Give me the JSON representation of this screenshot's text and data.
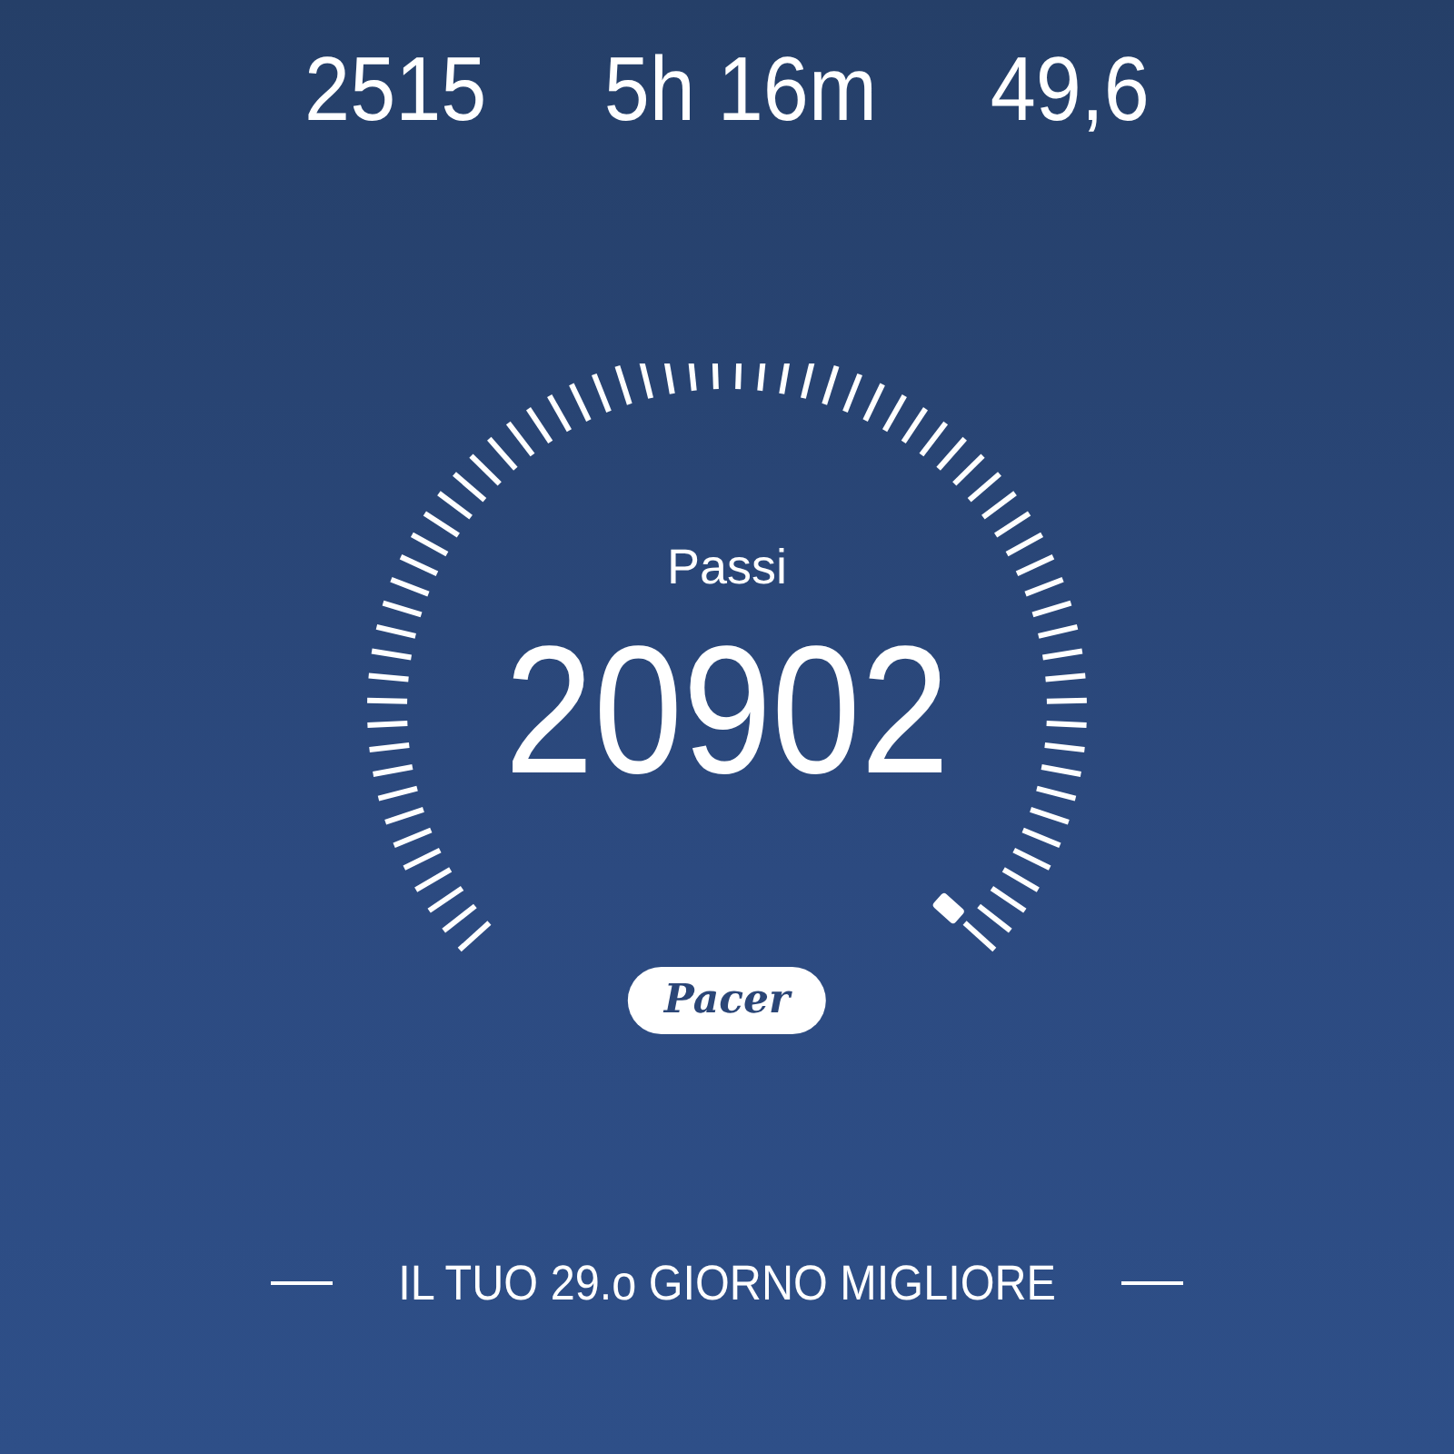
{
  "stats": [
    {
      "value": "2515"
    },
    {
      "value": "5h 16m"
    },
    {
      "value": "49,6"
    }
  ],
  "gauge": {
    "label": "Passi",
    "value": "20902"
  },
  "badge": "Pacer",
  "footer": "IL TUO 29.o GIORNO MIGLIORE"
}
